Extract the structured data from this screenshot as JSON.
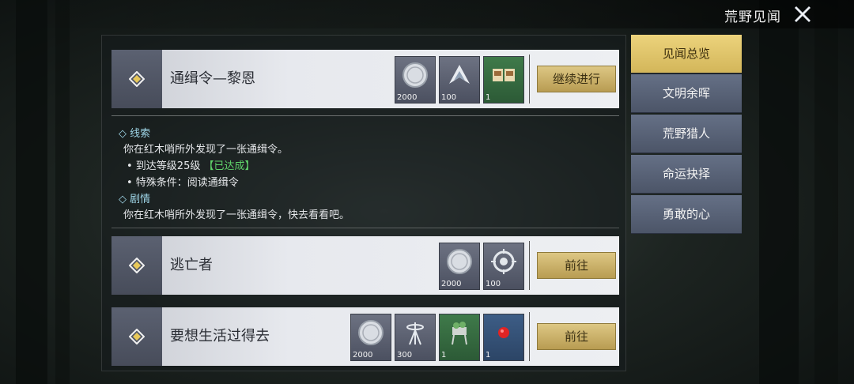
{
  "header": {
    "title": "荒野见闻"
  },
  "sidebar": {
    "items": [
      {
        "label": "见闻总览",
        "active": true
      },
      {
        "label": "文明余晖",
        "active": false
      },
      {
        "label": "荒野猎人",
        "active": false
      },
      {
        "label": "命运抉择",
        "active": false
      },
      {
        "label": "勇敢的心",
        "active": false
      }
    ]
  },
  "quests": [
    {
      "name": "通缉令—黎恩",
      "action": "继续进行",
      "rewards": [
        {
          "icon": "silver-coin-icon",
          "count": "2000"
        },
        {
          "icon": "level-up-arrow-icon",
          "count": "100"
        },
        {
          "icon": "wanted-poster-icon",
          "count": "1"
        }
      ]
    },
    {
      "name": "逃亡者",
      "action": "前往",
      "rewards": [
        {
          "icon": "silver-coin-icon",
          "count": "2000"
        },
        {
          "icon": "badge-emblem-icon",
          "count": "100"
        }
      ]
    },
    {
      "name": "要想生活过得去",
      "action": "前往",
      "rewards": [
        {
          "icon": "silver-coin-icon",
          "count": "2000"
        },
        {
          "icon": "antenna-tower-icon",
          "count": "300"
        },
        {
          "icon": "plant-stand-icon",
          "count": "1"
        },
        {
          "icon": "red-ball-icon",
          "count": "1"
        }
      ]
    }
  ],
  "details": {
    "clue_heading": "◇ 线索",
    "clue_text": "你在红木哨所外发现了一张通缉令。",
    "req1_text": "• 到达等级25级",
    "req1_status": "【已达成】",
    "req2_text": "• 特殊条件：阅读通缉令",
    "story_heading": "◇ 剧情",
    "story_text": "你在红木哨所外发现了一张通缉令，快去看看吧。"
  },
  "colors": {
    "gold": "#d3b65a",
    "completed": "#5fd36a",
    "heading": "#9fd6e8"
  }
}
